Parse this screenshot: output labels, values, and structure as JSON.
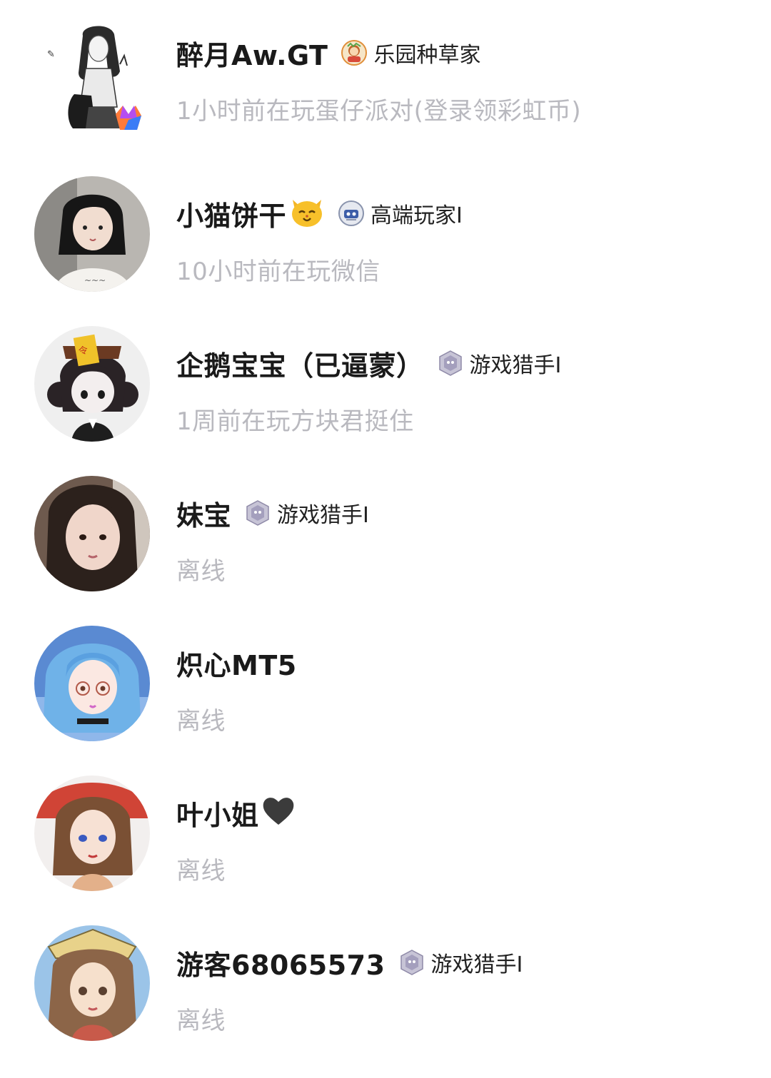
{
  "friends": [
    {
      "name": "醉月Aw.GT",
      "name_parts": [
        "醉月",
        "Aw.",
        "GT"
      ],
      "title_icon": "garden-badge-icon",
      "title": "乐园种草家",
      "status": "1小时前在玩蛋仔派对(登录领彩虹币)"
    },
    {
      "name": "小猫饼干",
      "name_emoji": "cat-face-icon",
      "title_icon": "hightier-badge-icon",
      "title": "高端玩家I",
      "status": "10小时前在玩微信"
    },
    {
      "name": "企鹅宝宝（已逼蒙）",
      "title_icon": "hunter-badge-icon",
      "title": "游戏猎手I",
      "status": "1周前在玩方块君挺住"
    },
    {
      "name": "妹宝",
      "title_icon": "hunter-badge-icon",
      "title": "游戏猎手I",
      "status": "离线"
    },
    {
      "name": "炽心MT5",
      "status": "离线"
    },
    {
      "name": "叶小姐",
      "name_emoji": "black-heart-icon",
      "status": "离线"
    },
    {
      "name": "游客68065573",
      "title_icon": "hunter-badge-icon",
      "title": "游戏猎手I",
      "status": "离线"
    }
  ],
  "colors": {
    "name": "#1a1a1a",
    "status": "#b9b9bf",
    "badge_text": "#222222",
    "background": "#ffffff"
  }
}
